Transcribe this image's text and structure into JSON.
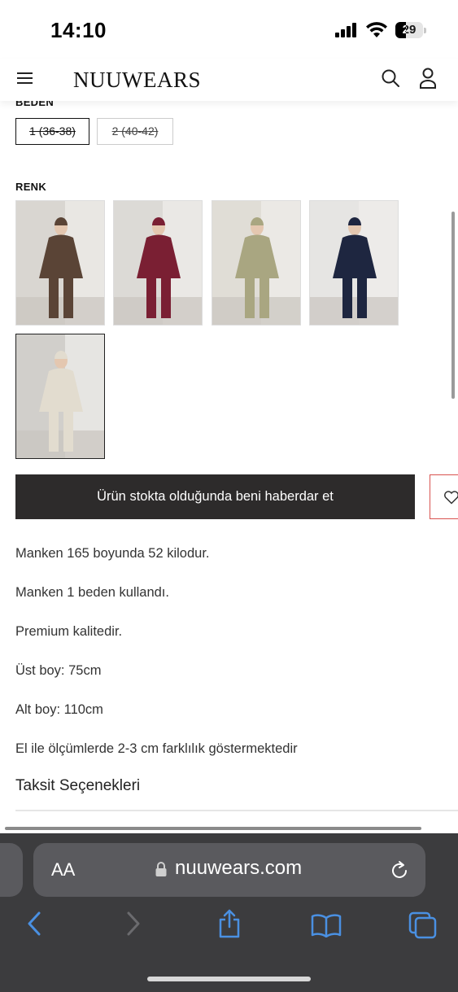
{
  "status": {
    "time": "14:10",
    "battery": "29"
  },
  "header": {
    "logo": "NUUWEARS"
  },
  "size_section": {
    "label": "BEDEN",
    "options": [
      {
        "label": "1 (36-38)",
        "selected": true
      },
      {
        "label": "2 (40-42)",
        "selected": false
      }
    ]
  },
  "color_section": {
    "label": "RENK",
    "swatches": [
      {
        "name": "brown",
        "color": "#5a4436",
        "bg": "#d9d6d1",
        "selected": false
      },
      {
        "name": "burgundy",
        "color": "#7a1f33",
        "bg": "#dcdad6",
        "selected": false
      },
      {
        "name": "khaki",
        "color": "#a9a681",
        "bg": "#e0ddd6",
        "selected": false
      },
      {
        "name": "navy",
        "color": "#1e2640",
        "bg": "#e6e5e3",
        "selected": false
      },
      {
        "name": "cream",
        "color": "#e2dccf",
        "bg": "#d1cfcb",
        "selected": true
      }
    ]
  },
  "actions": {
    "notify_label": "Ürün stokta olduğunda beni haberdar et"
  },
  "description": [
    "Manken 165 boyunda 52 kilodur.",
    "Manken 1 beden kullandı.",
    "Premium kalitedir.",
    "Üst boy: 75cm",
    "Alt boy: 110cm",
    "El ile ölçümlerde 2-3 cm farklılık göstermektedir"
  ],
  "installments": {
    "title": "Taksit Seçenekleri"
  },
  "browser": {
    "aa_label": "AA",
    "url": "nuuwears.com"
  },
  "icons": [
    "hamburger-icon",
    "search-icon",
    "user-icon",
    "heart-icon",
    "lock-icon",
    "reload-icon",
    "back-icon",
    "forward-icon",
    "share-icon",
    "bookmarks-icon",
    "tabs-icon"
  ]
}
